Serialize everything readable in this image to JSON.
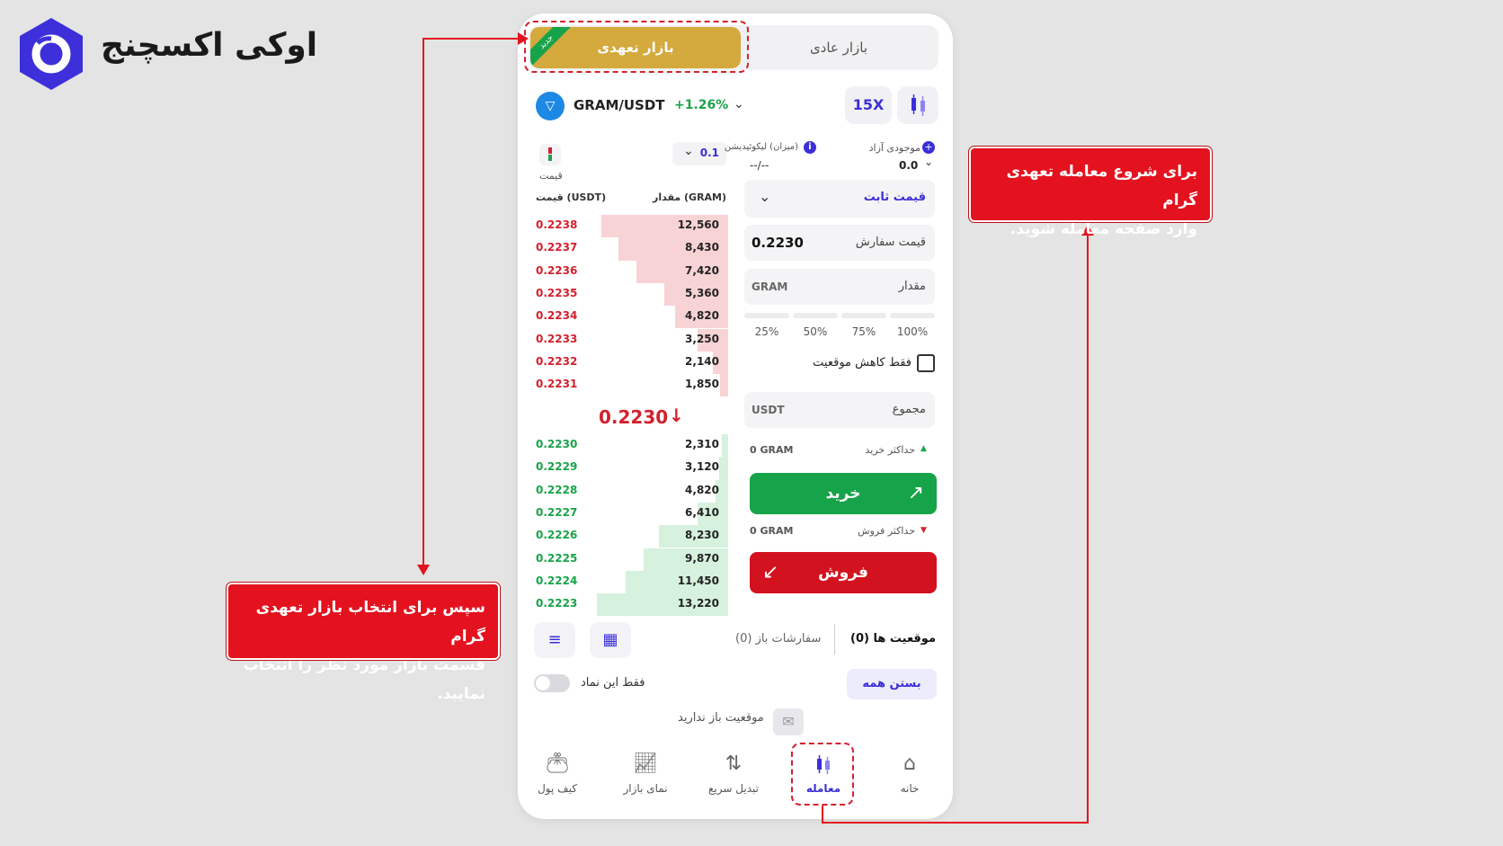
{
  "brand": {
    "name": "اوکی اکسچنج"
  },
  "market_tabs": {
    "futures": "بازار تعهدی",
    "futures_badge": "جدید",
    "spot": "بازار عادی"
  },
  "pair": {
    "symbol": "GRAM/USDT",
    "change": "+1.26%",
    "leverage": "15X"
  },
  "orderbook": {
    "tick_size": "0.1",
    "price_label": "قیمت",
    "col_qty": "مقدار (GRAM)",
    "col_price": "قیمت (USDT)",
    "asks": [
      {
        "price": "0.2238",
        "qty": "12,560",
        "depth": 0.83
      },
      {
        "price": "0.2237",
        "qty": "8,430",
        "depth": 0.72
      },
      {
        "price": "0.2236",
        "qty": "7,420",
        "depth": 0.6
      },
      {
        "price": "0.2235",
        "qty": "5,360",
        "depth": 0.42
      },
      {
        "price": "0.2234",
        "qty": "4,820",
        "depth": 0.35
      },
      {
        "price": "0.2233",
        "qty": "3,250",
        "depth": 0.2
      },
      {
        "price": "0.2232",
        "qty": "2,140",
        "depth": 0.1
      },
      {
        "price": "0.2231",
        "qty": "1,850",
        "depth": 0.05
      }
    ],
    "last_price": "0.2230",
    "bids": [
      {
        "price": "0.2230",
        "qty": "2,310",
        "depth": 0.04
      },
      {
        "price": "0.2229",
        "qty": "3,120",
        "depth": 0.06
      },
      {
        "price": "0.2228",
        "qty": "4,820",
        "depth": 0.08
      },
      {
        "price": "0.2227",
        "qty": "6,410",
        "depth": 0.2
      },
      {
        "price": "0.2226",
        "qty": "8,230",
        "depth": 0.45
      },
      {
        "price": "0.2225",
        "qty": "9,870",
        "depth": 0.55
      },
      {
        "price": "0.2224",
        "qty": "11,450",
        "depth": 0.67
      },
      {
        "price": "0.2223",
        "qty": "13,220",
        "depth": 0.86
      }
    ]
  },
  "order_form": {
    "free_balance_label": "موجودی آزاد",
    "free_balance_value": "0.0",
    "liquidation_label": "(میزان) لیکوئیدیشن",
    "liquidation_value": "--/--",
    "order_type": "قیمت ثابت",
    "order_price_label": "قیمت سفارش",
    "order_price_value": "0.2230",
    "amount_label": "مقدار",
    "amount_unit": "GRAM",
    "percents": [
      "25%",
      "50%",
      "75%",
      "100%"
    ],
    "reduce_only_label": "فقط کاهش موقعیت",
    "total_label": "مجموع",
    "total_unit": "USDT",
    "max_buy_label": "حداکثر خرید",
    "max_buy_value": "0 GRAM",
    "buy_label": "خرید",
    "max_sell_label": "حداکثر فروش",
    "max_sell_value": "0 GRAM",
    "sell_label": "فروش"
  },
  "positions": {
    "positions_tab": "موقعیت ها (0)",
    "open_orders_tab": "سفارشات باز (0)",
    "close_all": "بستن همه",
    "only_symbol": "فقط این نماد",
    "empty": "موقعیت باز ندارید"
  },
  "bottom_nav": [
    {
      "label": "خانه",
      "icon": "home-icon"
    },
    {
      "label": "معامله",
      "icon": "candlestick-icon"
    },
    {
      "label": "تبدیل سریع",
      "icon": "swap-icon"
    },
    {
      "label": "نمای بازار",
      "icon": "chart-icon"
    },
    {
      "label": "کیف پول",
      "icon": "wallet-icon"
    }
  ],
  "callouts": {
    "right": [
      "برای شروع معامله تعهدی گرام",
      "وارد صفحه معامله شوید."
    ],
    "left": [
      "سپس برای انتخاب بازار تعهدی گرام",
      "قسمت بازار مورد نظر را انتخاب نمایید."
    ]
  },
  "colors": {
    "accent_gold": "#d4a93d",
    "buy_green": "#17a34a",
    "sell_red": "#d3121f",
    "callout_red": "#e3121e",
    "brand_purple": "#3b2fd8"
  }
}
